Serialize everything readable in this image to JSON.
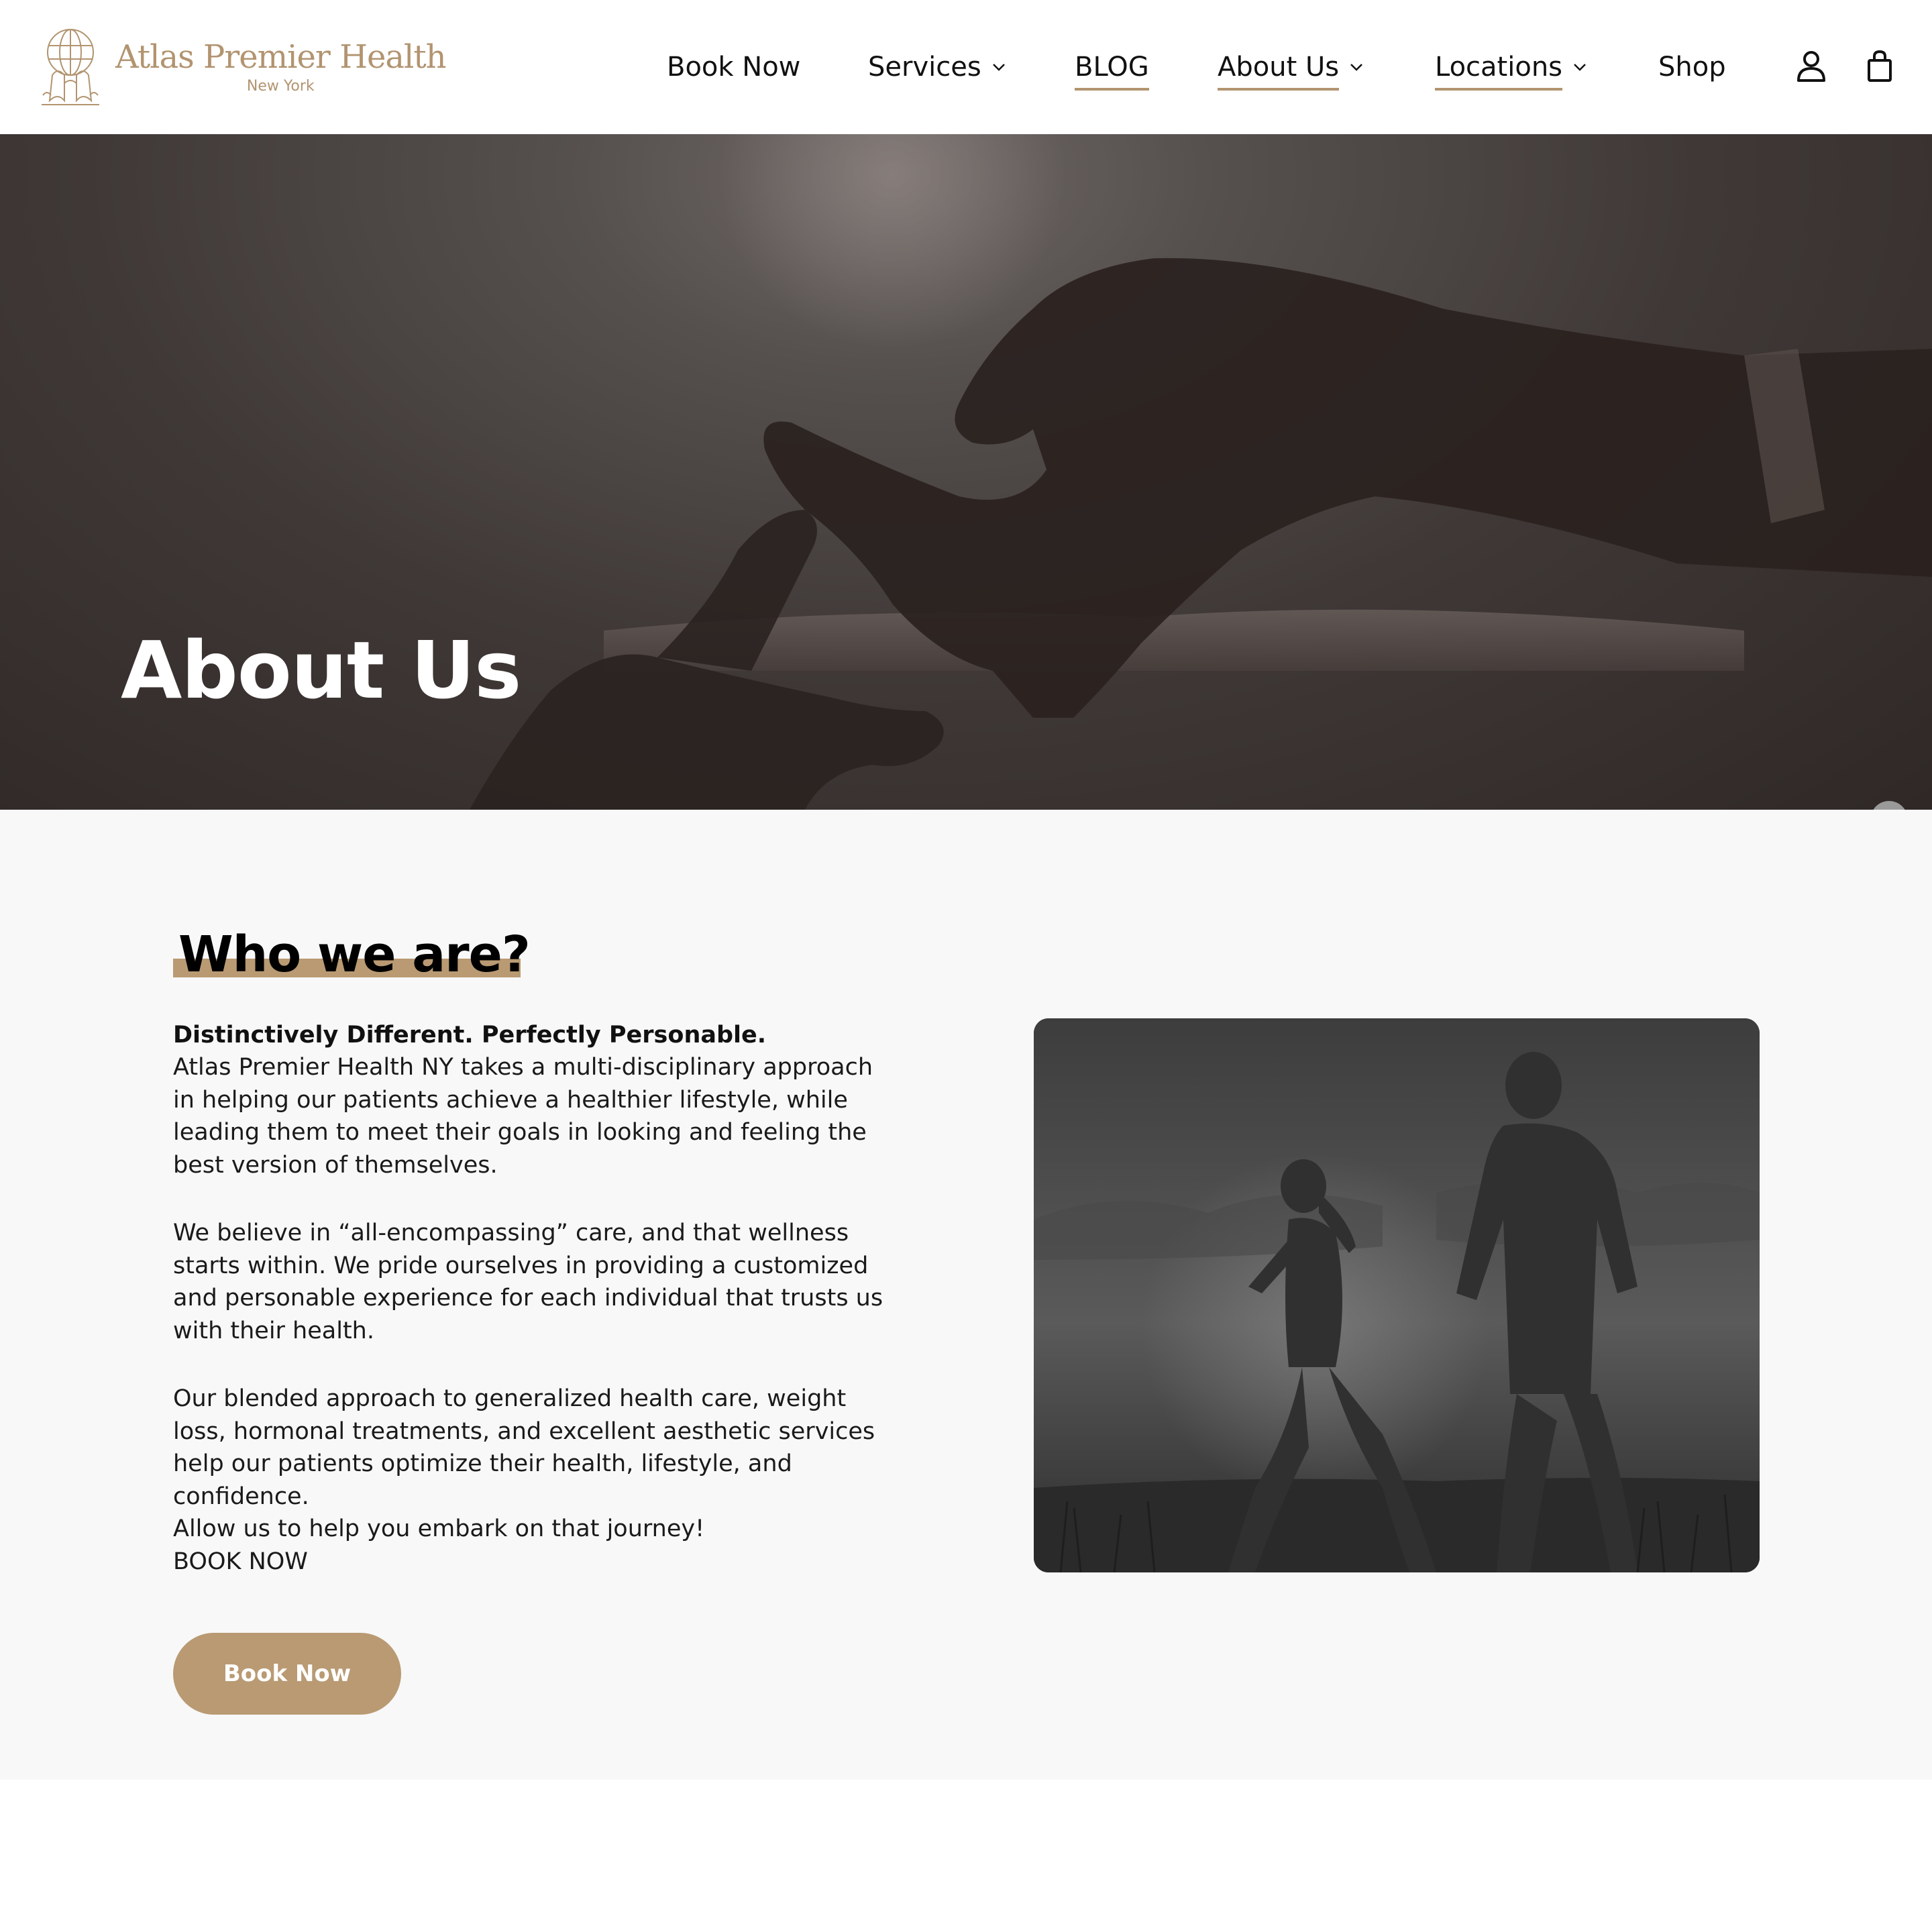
{
  "header": {
    "logo": {
      "name": "Atlas Premier Health",
      "subtitle": "New York",
      "icon": "globe-atlas-icon",
      "color": "#b29470"
    },
    "nav": [
      {
        "label": "Book Now",
        "has_dropdown": false,
        "underlined": false
      },
      {
        "label": "Services",
        "has_dropdown": true,
        "underlined": false
      },
      {
        "label": "BLOG",
        "has_dropdown": false,
        "underlined": true
      },
      {
        "label": "About Us",
        "has_dropdown": true,
        "underlined": true
      },
      {
        "label": "Locations",
        "has_dropdown": true,
        "underlined": true
      },
      {
        "label": "Shop",
        "has_dropdown": false,
        "underlined": false
      }
    ],
    "icons": [
      "account-icon",
      "shopping-bag-icon"
    ]
  },
  "hero": {
    "title": "About Us",
    "image": "hands-framing-gesture-silhouette"
  },
  "about": {
    "heading": "Who we are?",
    "tagline": "Distinctively Different. Perfectly Personable.",
    "para1_lines": [
      "Atlas Premier Health NY takes a multi-disciplinary approach",
      "in helping our patients achieve a healthier lifestyle, while",
      "leading them to meet their goals in looking and feeling the",
      "best version of themselves."
    ],
    "para2_lines": [
      "We believe in “all-encompassing” care, and that wellness",
      "starts within. We pride ourselves in providing a customized",
      "and personable experience for each individual that trusts us",
      "with their health."
    ],
    "para3_lines": [
      "Our blended approach to generalized health care, weight",
      "loss, hormonal treatments, and excellent aesthetic services",
      "help our patients optimize their health, lifestyle, and",
      "confidence.",
      "Allow us to help you embark on that journey!",
      "BOOK NOW"
    ],
    "button_label": "Book Now",
    "image": "couple-running-silhouette"
  },
  "colors": {
    "accent": "#b99a73",
    "hero_overlay": "#3f3836",
    "section_bg": "#f8f8f8"
  }
}
